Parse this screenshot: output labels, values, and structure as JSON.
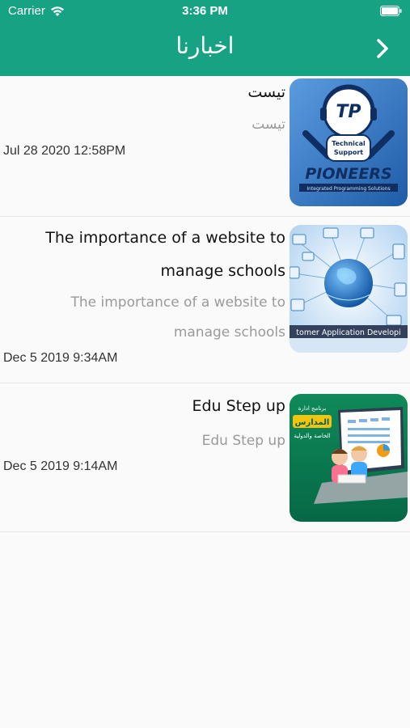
{
  "status_bar": {
    "carrier": "Carrier",
    "time": "3:36 PM",
    "icons": [
      "wifi-icon",
      "battery-icon"
    ]
  },
  "nav": {
    "title": "اخبارنا",
    "back_icon": "chevron-right-icon"
  },
  "colors": {
    "header": "#17a383",
    "title_text": "#111111",
    "subtitle_text": "#9a9a9a",
    "date_text": "#333333",
    "background": "#fafafa"
  },
  "news": [
    {
      "title": "تيست",
      "subtitle": "تيست",
      "date": "Jul 28 2020 12:58PM",
      "thumbnail": {
        "icon": "pioneers-technical-support-logo",
        "badge_line1": "Technical",
        "badge_line2": "Support",
        "brand": "PIONEERS",
        "tagline": "Integrated Programming Solutions"
      }
    },
    {
      "title": "The importance of a website to manage schools",
      "subtitle": "The importance of a website to manage schools",
      "date": "Dec  5 2019  9:34AM",
      "thumbnail": {
        "icon": "globe-network-illustration",
        "caption": "tomer Application Developi"
      }
    },
    {
      "title": "Edu Step up",
      "subtitle": "Edu Step up",
      "date": "Dec  5 2019  9:14AM",
      "thumbnail": {
        "icon": "school-program-kids-laptop-illustration",
        "label_1": "برنامج ادارة",
        "label_2": "المدارس",
        "label_3": "الخاصة والدولية"
      }
    }
  ]
}
